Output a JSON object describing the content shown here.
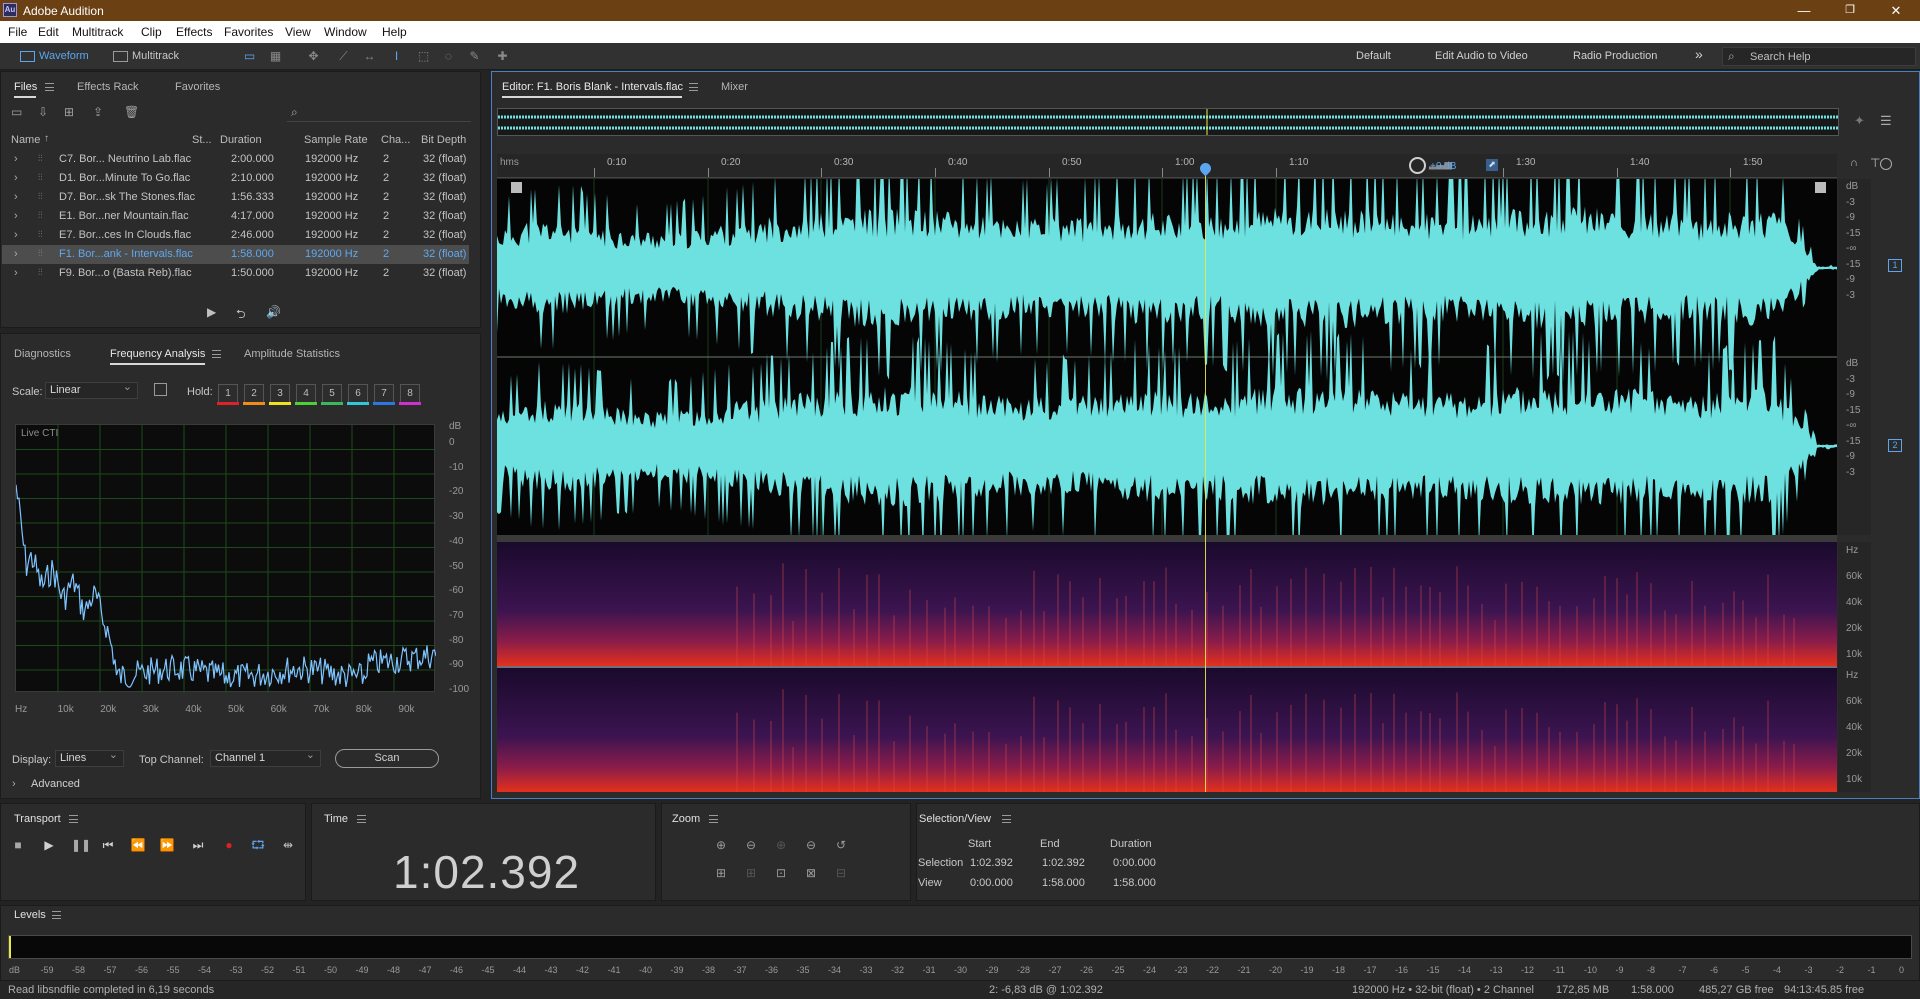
{
  "window": {
    "title": "Adobe Audition",
    "app_icon": "Au",
    "controls": [
      "—",
      "❐",
      "✕"
    ]
  },
  "menu": [
    "File",
    "Edit",
    "Multitrack",
    "Clip",
    "Effects",
    "Favorites",
    "View",
    "Window",
    "Help"
  ],
  "toolbar": {
    "waveform_label": "Waveform",
    "multitrack_label": "Multitrack",
    "workspaces": [
      "Default",
      "Edit Audio to Video",
      "Radio Production"
    ],
    "more": "»",
    "search_placeholder": "Search Help"
  },
  "files_panel": {
    "tabs": [
      "Files",
      "Effects Rack",
      "Favorites"
    ],
    "columns": [
      "Name",
      "St...",
      "Duration",
      "Sample Rate",
      "Cha...",
      "Bit Depth"
    ],
    "sort_arrow": "↑",
    "search_icon": "⌕",
    "rows": [
      {
        "name": "C7. Bor... Neutrino Lab.flac",
        "duration": "2:00.000",
        "rate": "192000 Hz",
        "ch": "2",
        "depth": "32 (float)"
      },
      {
        "name": "D1. Bor...Minute To Go.flac",
        "duration": "2:10.000",
        "rate": "192000 Hz",
        "ch": "2",
        "depth": "32 (float)"
      },
      {
        "name": "D7. Bor...sk The Stones.flac",
        "duration": "1:56.333",
        "rate": "192000 Hz",
        "ch": "2",
        "depth": "32 (float)"
      },
      {
        "name": "E1. Bor...ner Mountain.flac",
        "duration": "4:17.000",
        "rate": "192000 Hz",
        "ch": "2",
        "depth": "32 (float)"
      },
      {
        "name": "E7. Bor...ces In Clouds.flac",
        "duration": "2:46.000",
        "rate": "192000 Hz",
        "ch": "2",
        "depth": "32 (float)"
      },
      {
        "name": "F1. Bor...ank - Intervals.flac",
        "duration": "1:58.000",
        "rate": "192000 Hz",
        "ch": "2",
        "depth": "32 (float)",
        "selected": true
      },
      {
        "name": "F9. Bor...o (Basta Reb).flac",
        "duration": "1:50.000",
        "rate": "192000 Hz",
        "ch": "2",
        "depth": "32 (float)"
      }
    ]
  },
  "analysis_panel": {
    "tabs": [
      "Diagnostics",
      "Frequency Analysis",
      "Amplitude Statistics"
    ],
    "scale_label": "Scale:",
    "scale_value": "Linear",
    "hold_label": "Hold:",
    "hold_buttons": [
      "1",
      "2",
      "3",
      "4",
      "5",
      "6",
      "7",
      "8"
    ],
    "hold_colors": [
      "#e0202a",
      "#f08c1c",
      "#f0e020",
      "#4ccf3a",
      "#3ab85a",
      "#2fc8d8",
      "#2a78e0",
      "#d030d0"
    ],
    "graph_label": "Live CTI",
    "db_unit": "dB",
    "db_ticks": [
      "0",
      "-10",
      "-20",
      "-30",
      "-40",
      "-50",
      "-60",
      "-70",
      "-80",
      "-90",
      "-100"
    ],
    "hz_ticks": [
      "Hz",
      "10k",
      "20k",
      "30k",
      "40k",
      "50k",
      "60k",
      "70k",
      "80k",
      "90k"
    ],
    "display_label": "Display:",
    "display_value": "Lines",
    "top_channel_label": "Top Channel:",
    "top_channel_value": "Channel 1",
    "scan_label": "Scan",
    "advanced_label": "Advanced"
  },
  "editor": {
    "tab_title": "Editor: F1. Boris Blank - Intervals.flac",
    "mixer_tab": "Mixer",
    "time_unit": "hms",
    "ruler_ticks": [
      "0:10",
      "0:20",
      "0:30",
      "0:40",
      "0:50",
      "1:00",
      "1:10",
      "1:30",
      "1:40",
      "1:50"
    ],
    "volume_label": "+0 dB",
    "db_scale": [
      "dB",
      "-3",
      "-9",
      "-15",
      "-∞",
      "-15",
      "-9",
      "-3"
    ],
    "channel_badges": [
      "1",
      "2"
    ],
    "spectral_scale": [
      "Hz",
      "60k",
      "40k",
      "20k",
      "10k"
    ]
  },
  "transport": {
    "title": "Transport"
  },
  "time_panel": {
    "title": "Time",
    "value": "1:02.392"
  },
  "zoom_panel": {
    "title": "Zoom"
  },
  "selection_panel": {
    "title": "Selection/View",
    "headers": [
      "Start",
      "End",
      "Duration"
    ],
    "selection_label": "Selection",
    "view_label": "View",
    "selection": [
      "1:02.392",
      "1:02.392",
      "0:00.000"
    ],
    "view": [
      "0:00.000",
      "1:58.000",
      "1:58.000"
    ]
  },
  "levels": {
    "title": "Levels",
    "scale": [
      "dB",
      "-59",
      "-58",
      "-57",
      "-56",
      "-55",
      "-54",
      "-53",
      "-52",
      "-51",
      "-50",
      "-49",
      "-48",
      "-47",
      "-46",
      "-45",
      "-44",
      "-43",
      "-42",
      "-41",
      "-40",
      "-39",
      "-38",
      "-37",
      "-36",
      "-35",
      "-34",
      "-33",
      "-32",
      "-31",
      "-30",
      "-29",
      "-28",
      "-27",
      "-26",
      "-25",
      "-24",
      "-23",
      "-22",
      "-21",
      "-20",
      "-19",
      "-18",
      "-17",
      "-16",
      "-15",
      "-14",
      "-13",
      "-12",
      "-11",
      "-10",
      "-9",
      "-8",
      "-7",
      "-6",
      "-5",
      "-4",
      "-3",
      "-2",
      "-1",
      "0"
    ]
  },
  "status": {
    "message": "Read libsndfile completed in 6,19 seconds",
    "cursor": "2: -6,83 dB @ 1:02.392",
    "format": "192000 Hz • 32-bit (float) • 2 Channel",
    "size": "172,85 MB",
    "duration": "1:58.000",
    "free": "485,27 GB free",
    "time_free": "94:13:45.85 free"
  },
  "colors": {
    "waveform": "#6de0e0",
    "playhead": "#e8e84a",
    "title_bar": "#6b4114",
    "accent": "#5ba6ef"
  }
}
